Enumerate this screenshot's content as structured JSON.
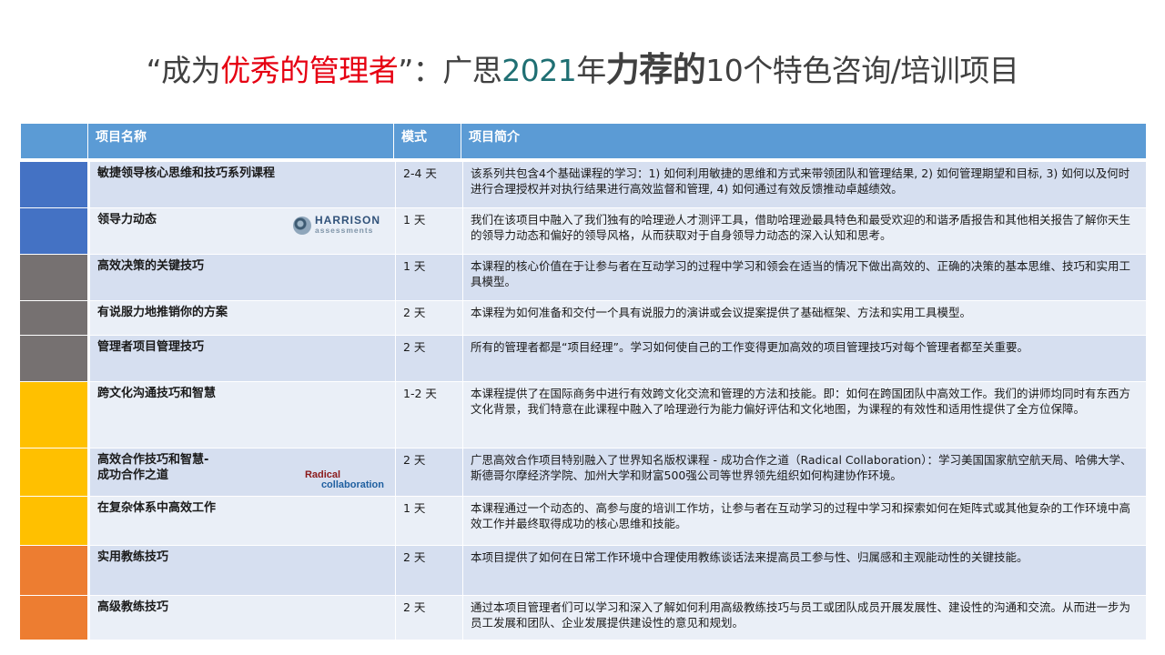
{
  "title": {
    "part1": "“成为",
    "highlight": "优秀的管理者",
    "part2": "”：广思",
    "year": "2021",
    "part3": "年",
    "bold": "力荐的",
    "part4": "10个特色",
    "part5": "咨询/培训项目"
  },
  "table": {
    "headers": {
      "name": "项目名称",
      "mode": "模式",
      "desc": "项目简介"
    },
    "rows": [
      {
        "name": "敏捷领导核心思维和技巧系列课程",
        "mode": "2-4 天",
        "desc": "该系列共包含4个基础课程的学习：1) 如何利用敏捷的思维和方式来带领团队和管理结果, 2) 如何管理期望和目标, 3) 如何以及何时进行合理授权并对执行结果进行高效监督和管理, 4) 如何通过有效反馈推动卓越绩效。",
        "color": "#4472c4"
      },
      {
        "name": "领导力动态",
        "mode": "1 天",
        "desc": "我们在该项目中融入了我们独有的哈理逊人才测评工具，借助哈理逊最具特色和最受欢迎的和谐矛盾报告和其他相关报告了解你天生的领导力动态和偏好的领导风格，从而获取对于自身领导力动态的深入认知和思考。",
        "color": "#4472c4"
      },
      {
        "name": "高效决策的关键技巧",
        "mode": "1 天",
        "desc": "本课程的核心价值在于让参与者在互动学习的过程中学习和领会在适当的情况下做出高效的、正确的决策的基本思维、技巧和实用工具模型。",
        "color": "#767171"
      },
      {
        "name": "有说服力地推销你的方案",
        "mode": "2 天",
        "desc": "本课程为如何准备和交付一个具有说服力的演讲或会议提案提供了基础框架、方法和实用工具模型。",
        "color": "#767171"
      },
      {
        "name": "管理者项目管理技巧",
        "mode": "2 天",
        "desc": "所有的管理者都是“项目经理”。学习如何使自己的工作变得更加高效的项目管理技巧对每个管理者都至关重要。",
        "color": "#767171"
      },
      {
        "name": "跨文化沟通技巧和智慧",
        "mode": "1-2 天",
        "desc": "本课程提供了在国际商务中进行有效跨文化交流和管理的方法和技能。即：如何在跨国团队中高效工作。我们的讲师均同时有东西方文化背景，我们特意在此课程中融入了哈理逊行为能力偏好评估和文化地图，为课程的有效性和适用性提供了全方位保障。",
        "color": "#ffc000"
      },
      {
        "name": "高效合作技巧和智慧-\n成功合作之道",
        "mode": "2 天",
        "desc": "广思高效合作项目特别融入了世界知名版权课程 - 成功合作之道（Radical Collaboration）：学习美国国家航空航天局、哈佛大学、斯德哥尔摩经济学院、加州大学和财富500强公司等世界领先组织如何构建协作环境。",
        "color": "#ffc000"
      },
      {
        "name": "在复杂体系中高效工作",
        "mode": "1 天",
        "desc": "本课程通过一个动态的、高参与度的培训工作坊，让参与者在互动学习的过程中学习和探索如何在矩阵式或其他复杂的工作环境中高效工作并最终取得成功的核心思维和技能。",
        "color": "#ffc000"
      },
      {
        "name": "实用教练技巧",
        "mode": "2 天",
        "desc": "本项目提供了如何在日常工作环境中合理使用教练谈话法来提高员工参与性、归属感和主观能动性的关键技能。",
        "color": "#ed7d31"
      },
      {
        "name": "高级教练技巧",
        "mode": "2 天",
        "desc": "通过本项目管理者们可以学习和深入了解如何利用高级教练技巧与员工或团队成员开展发展性、建设性的沟通和交流。从而进一步为员工发展和团队、企业发展提供建设性的意见和规划。",
        "color": "#ed7d31"
      }
    ]
  },
  "logos": {
    "harrison_main": "HARRISON",
    "harrison_sub": "assessments",
    "radical_1": "Radical",
    "radical_2": "collaboration"
  }
}
